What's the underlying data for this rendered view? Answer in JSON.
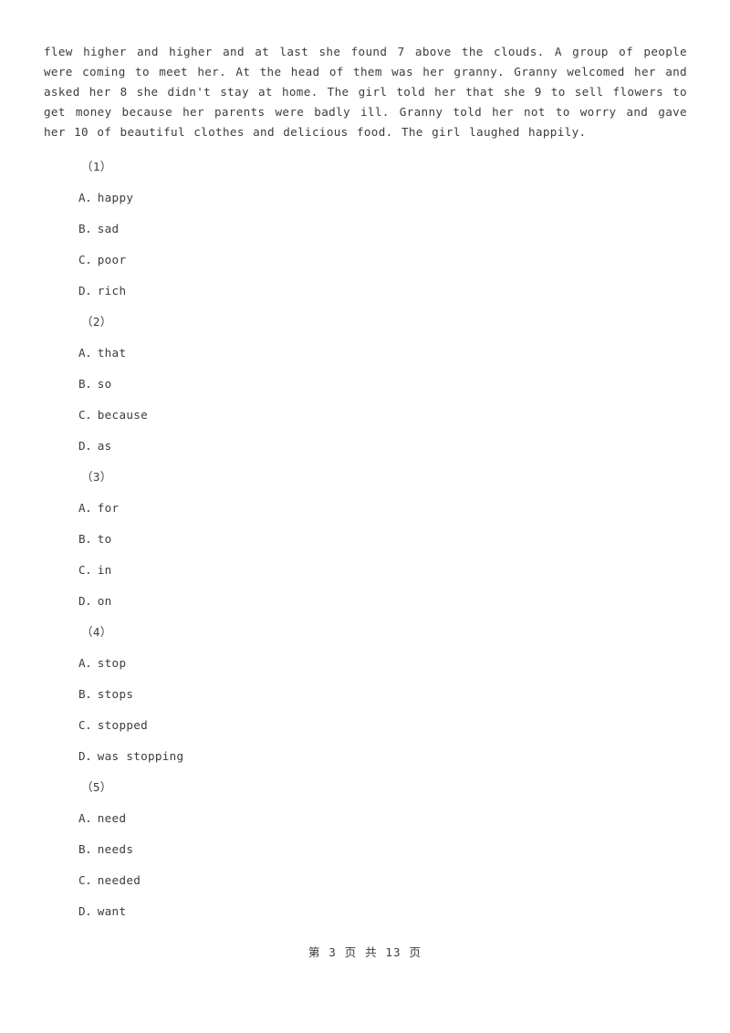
{
  "passage": {
    "text": "flew higher and higher and at last she found 7 above the clouds. A group of people were coming to meet her. At the head of them was her granny. Granny welcomed her and asked her 8 she didn't stay at home. The girl told her that she 9 to sell flowers to get money because her parents were badly ill. Granny told her not to worry and gave her 10 of beautiful clothes and delicious food. The girl laughed happily."
  },
  "questions": [
    {
      "number": "（1）",
      "options": [
        {
          "letter": "A",
          "separator": "．",
          "text": "happy"
        },
        {
          "letter": "B",
          "separator": "．",
          "text": "sad"
        },
        {
          "letter": "C",
          "separator": "．",
          "text": "poor"
        },
        {
          "letter": "D",
          "separator": "．",
          "text": "rich"
        }
      ]
    },
    {
      "number": "（2）",
      "options": [
        {
          "letter": "A",
          "separator": "．",
          "text": "that"
        },
        {
          "letter": "B",
          "separator": "．",
          "text": "so"
        },
        {
          "letter": "C",
          "separator": "．",
          "text": "because"
        },
        {
          "letter": "D",
          "separator": "．",
          "text": "as"
        }
      ]
    },
    {
      "number": "（3）",
      "options": [
        {
          "letter": "A",
          "separator": "．",
          "text": "for"
        },
        {
          "letter": "B",
          "separator": "．",
          "text": "to"
        },
        {
          "letter": "C",
          "separator": "．",
          "text": "in"
        },
        {
          "letter": "D",
          "separator": "．",
          "text": "on"
        }
      ]
    },
    {
      "number": "（4）",
      "options": [
        {
          "letter": "A",
          "separator": "．",
          "text": "stop"
        },
        {
          "letter": "B",
          "separator": "．",
          "text": "stops"
        },
        {
          "letter": "C",
          "separator": "．",
          "text": "stopped"
        },
        {
          "letter": "D",
          "separator": "．",
          "text": "was stopping"
        }
      ]
    },
    {
      "number": "（5）",
      "options": [
        {
          "letter": "A",
          "separator": "．",
          "text": "need"
        },
        {
          "letter": "B",
          "separator": "．",
          "text": "needs"
        },
        {
          "letter": "C",
          "separator": "．",
          "text": "needed"
        },
        {
          "letter": "D",
          "separator": "．",
          "text": "want"
        }
      ]
    }
  ],
  "footer": {
    "text": "第 3 页 共 13 页"
  }
}
